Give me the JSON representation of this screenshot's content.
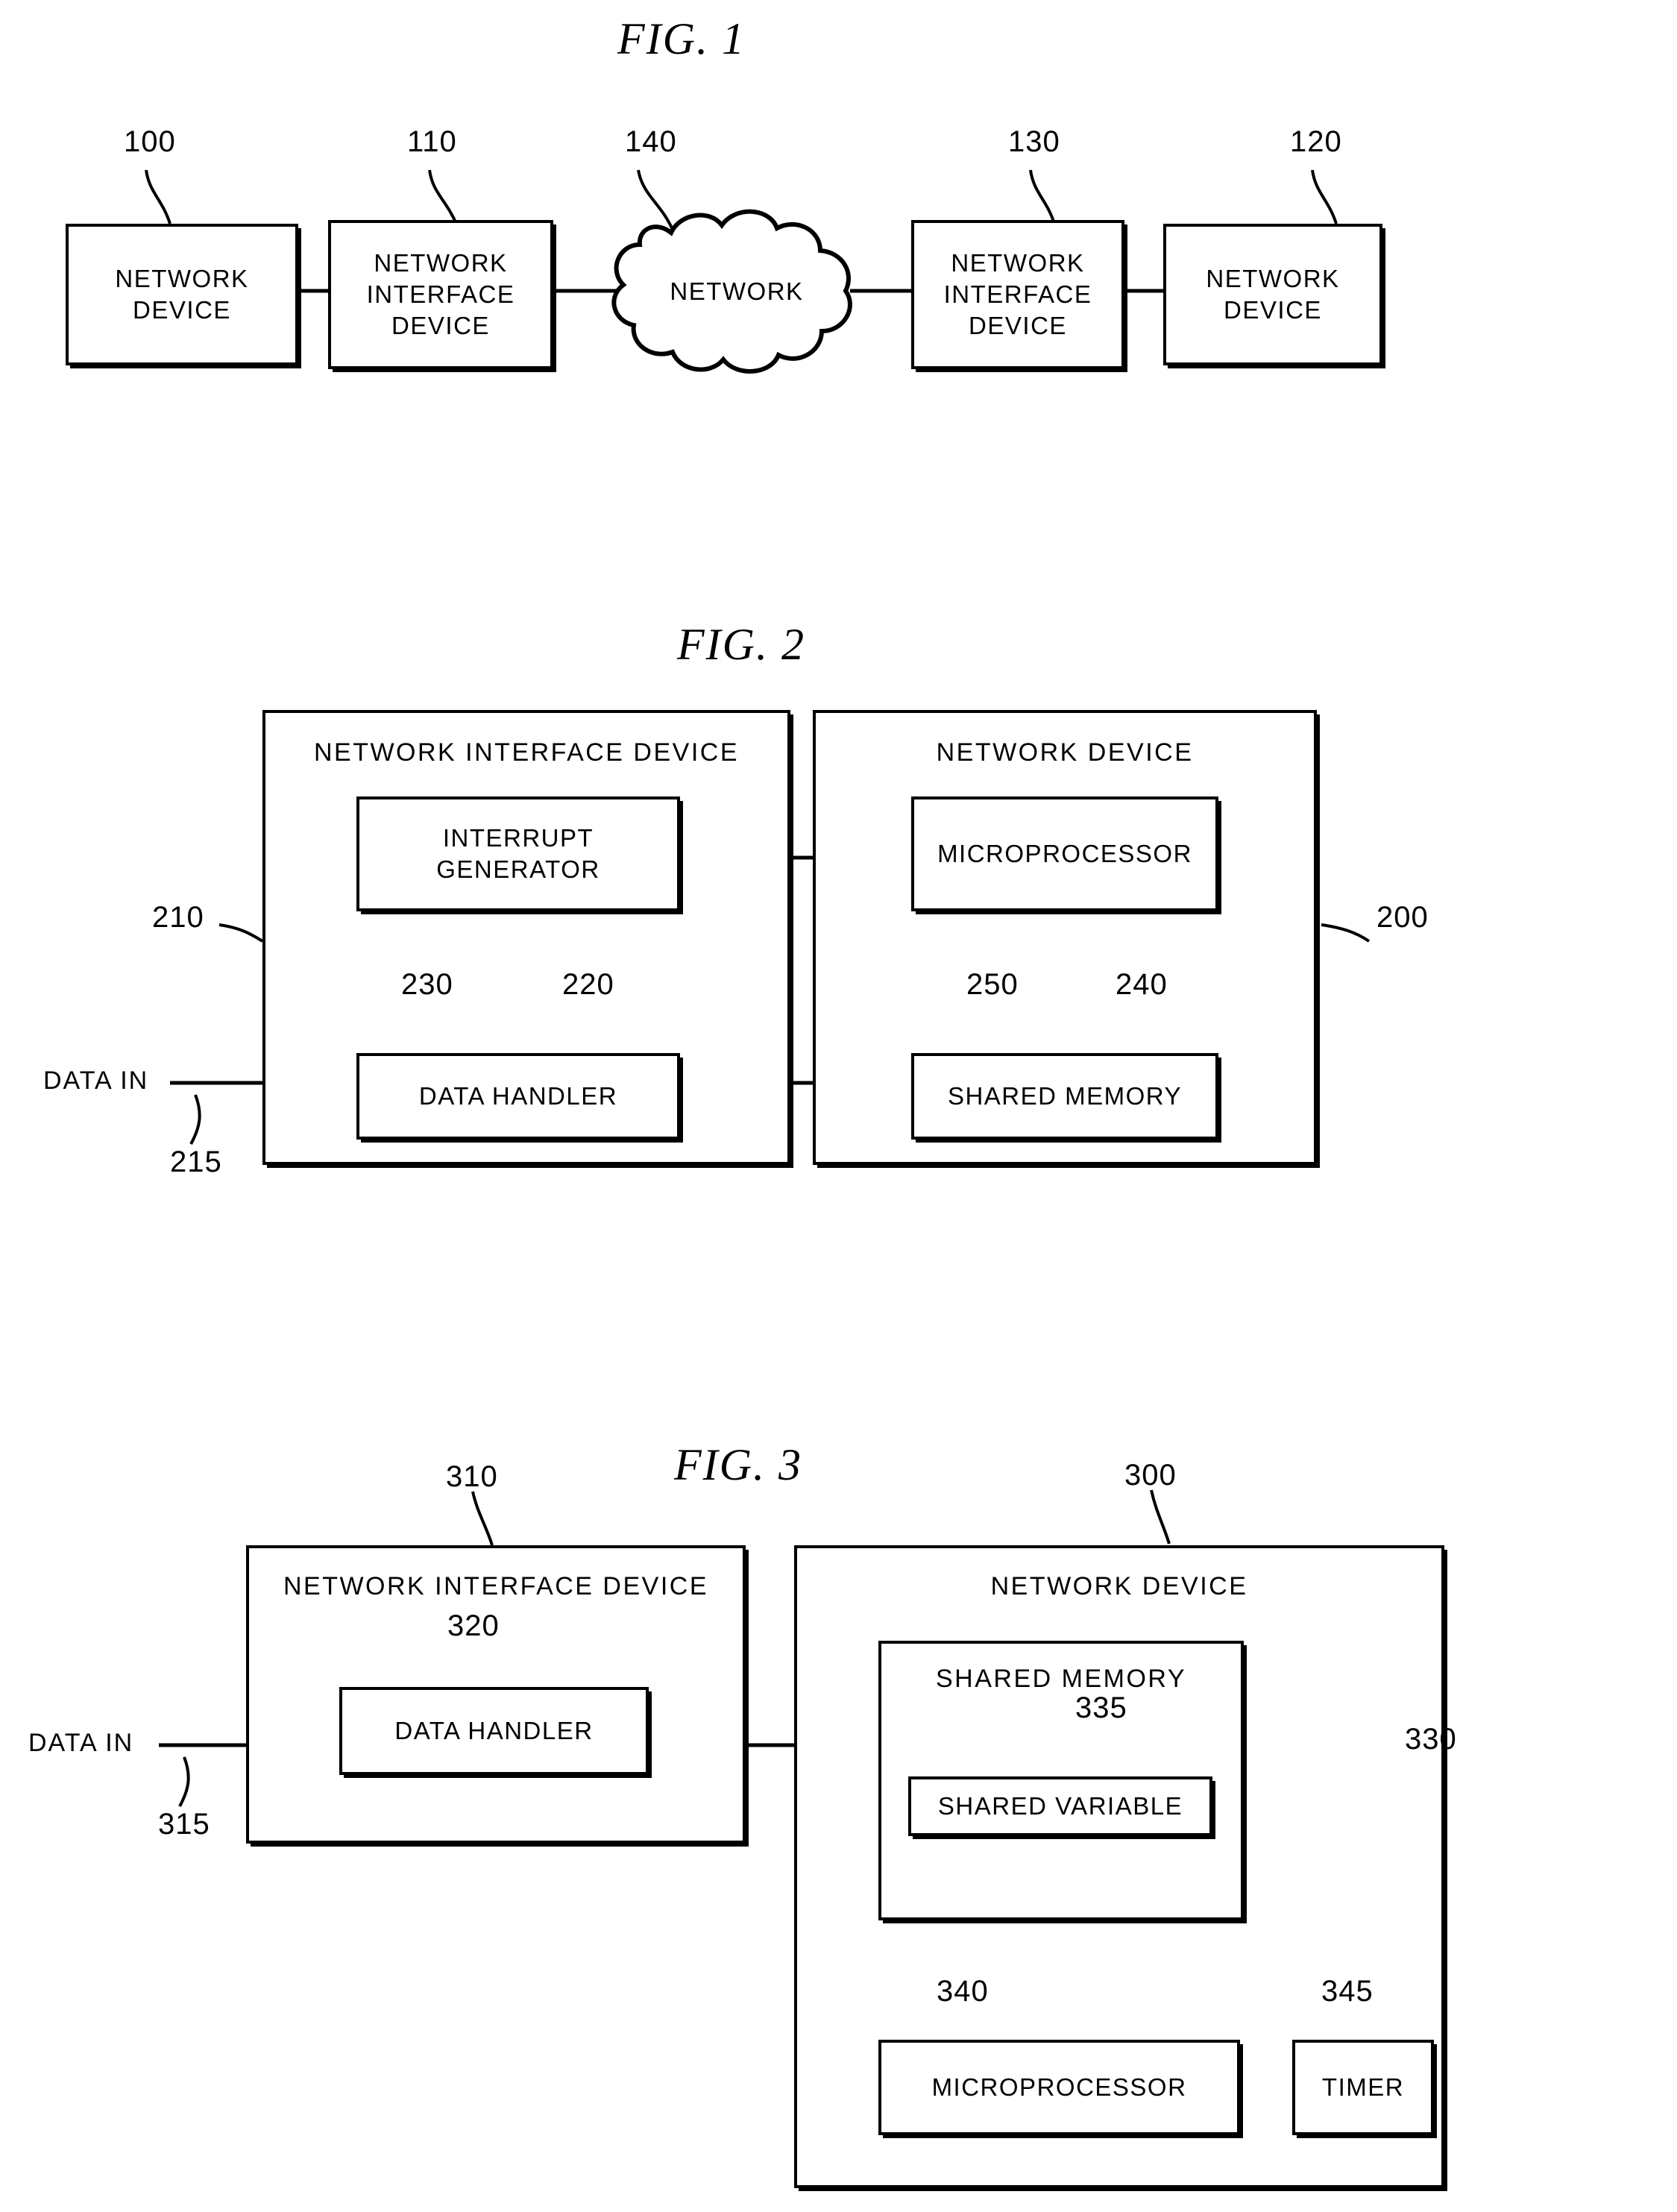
{
  "document": {
    "type": "patent-drawing-sheet",
    "figure_titles": [
      "FIG.  1",
      "FIG.  2",
      "FIG.  3"
    ]
  },
  "figure1": {
    "title": "FIG.  1",
    "blocks": [
      {
        "id": "nd-left",
        "label": "NETWORK\nDEVICE",
        "ref": "100"
      },
      {
        "id": "nid-left",
        "label": "NETWORK\nINTERFACE\nDEVICE",
        "ref": "110"
      },
      {
        "id": "cloud",
        "label": "NETWORK",
        "ref": "140"
      },
      {
        "id": "nid-right",
        "label": "NETWORK\nINTERFACE\nDEVICE",
        "ref": "130"
      },
      {
        "id": "nd-right",
        "label": "NETWORK\nDEVICE",
        "ref": "120"
      }
    ]
  },
  "figure2": {
    "title": "FIG.  2",
    "network_interface_device": {
      "caption": "NETWORK  INTERFACE  DEVICE",
      "ref": "210",
      "children": [
        {
          "id": "interrupt-generator",
          "label": "INTERRUPT\nGENERATOR",
          "ref": "230"
        },
        {
          "id": "data-handler",
          "label": "DATA HANDLER",
          "ref": "220"
        }
      ]
    },
    "network_device": {
      "caption": "NETWORK  DEVICE",
      "ref": "200",
      "children": [
        {
          "id": "microprocessor",
          "label": "MICROPROCESSOR",
          "ref": "250"
        },
        {
          "id": "shared-memory",
          "label": "SHARED  MEMORY",
          "ref": "240"
        }
      ]
    },
    "data_in": {
      "label": "DATA  IN",
      "ref": "215"
    }
  },
  "figure3": {
    "title": "FIG.  3",
    "network_interface_device": {
      "caption": "NETWORK  INTERFACE  DEVICE",
      "ref": "310",
      "children": [
        {
          "id": "data-handler",
          "label": "DATA HANDLER",
          "ref": "320"
        }
      ]
    },
    "network_device": {
      "caption": "NETWORK  DEVICE",
      "ref": "300",
      "children": [
        {
          "id": "shared-memory",
          "label": "SHARED  MEMORY",
          "ref": "330"
        },
        {
          "id": "shared-variable",
          "label": "SHARED VARIABLE",
          "ref": "335"
        },
        {
          "id": "microprocessor",
          "label": "MICROPROCESSOR",
          "ref": "340"
        },
        {
          "id": "timer",
          "label": "TIMER",
          "ref": "345"
        }
      ]
    },
    "data_in": {
      "label": "DATA  IN",
      "ref": "315"
    }
  }
}
